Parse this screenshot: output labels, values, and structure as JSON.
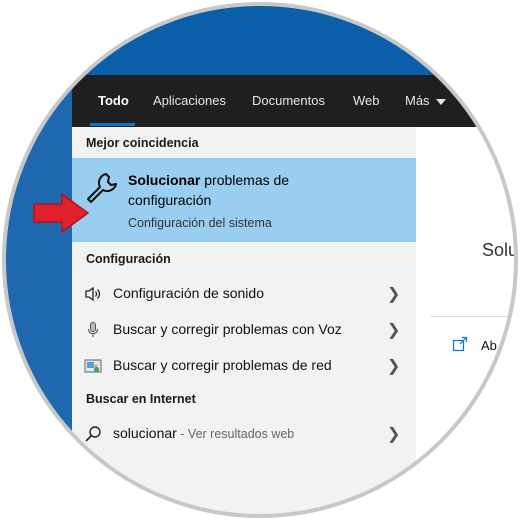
{
  "tabs": [
    {
      "label": "Todo"
    },
    {
      "label": "Aplicaciones"
    },
    {
      "label": "Documentos"
    },
    {
      "label": "Web"
    },
    {
      "label": "Más"
    }
  ],
  "best_match": {
    "section": "Mejor coincidencia",
    "title_bold": "Solucionar",
    "title_rest": " problemas de configuración",
    "subtitle": "Configuración del sistema",
    "icon": "wrench-icon"
  },
  "settings": {
    "section": "Configuración",
    "items": [
      {
        "label": "Configuración de sonido",
        "icon": "speaker-icon"
      },
      {
        "label": "Buscar y corregir problemas con Voz",
        "icon": "microphone-icon"
      },
      {
        "label": "Buscar y corregir problemas de red",
        "icon": "network-icon"
      }
    ]
  },
  "internet": {
    "section": "Buscar en Internet",
    "query": "solucionar",
    "hint": " - Ver resultados web",
    "icon": "search-icon"
  },
  "preview": {
    "title_partial": "Solu",
    "open_partial": "Ab",
    "icon": "open-icon"
  },
  "colors": {
    "accent": "#0078d7",
    "highlight": "#99cef0",
    "topbar": "#1f1f1f",
    "arrow": "#e0202a"
  }
}
